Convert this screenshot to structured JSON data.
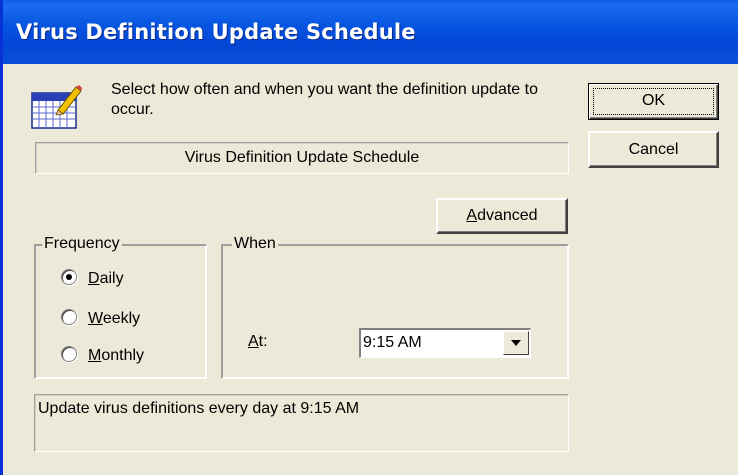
{
  "window": {
    "title": "Virus Definition Update Schedule"
  },
  "intro": {
    "text": "Select how often and when you want the definition update to occur.",
    "icon": "calendar-edit-icon"
  },
  "banner": {
    "text": "Virus Definition Update Schedule"
  },
  "buttons": {
    "ok": "OK",
    "cancel": "Cancel",
    "advanced_prefix": "",
    "advanced_mnemonic": "A",
    "advanced_rest": "dvanced"
  },
  "frequency": {
    "legend": "Frequency",
    "selected": "Daily",
    "options": [
      {
        "mnemonic": "D",
        "rest": "aily"
      },
      {
        "mnemonic": "W",
        "rest": "eekly"
      },
      {
        "mnemonic": "M",
        "rest": "onthly"
      }
    ]
  },
  "when": {
    "legend": "When",
    "at_mnemonic": "A",
    "at_rest": "t:",
    "time_value": "9:15 AM"
  },
  "status": {
    "text": "Update virus definitions every day at 9:15 AM"
  },
  "colors": {
    "title_bar": "#0655e0",
    "face": "#ece9d8"
  }
}
